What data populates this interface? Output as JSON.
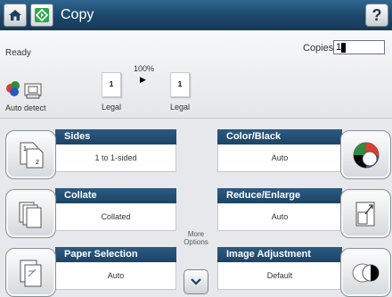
{
  "header": {
    "title": "Copy",
    "home_icon": "home-icon",
    "app_icon": "copy-start-icon",
    "help_label": "?"
  },
  "status": {
    "state": "Ready",
    "copies_label": "Copies:",
    "copies_value": "1",
    "zoom": "100%",
    "original_page": "1",
    "original_paper": "Legal",
    "output_page": "1",
    "output_paper": "Legal",
    "detect_label": "Auto detect"
  },
  "tiles": {
    "sides": {
      "title": "Sides",
      "value": "1 to 1-sided"
    },
    "collate": {
      "title": "Collate",
      "value": "Collated"
    },
    "paper_selection": {
      "title": "Paper Selection",
      "value": "Auto"
    },
    "color_black": {
      "title": "Color/Black",
      "value": "Auto"
    },
    "reduce_enlarge": {
      "title": "Reduce/Enlarge",
      "value": "Auto"
    },
    "image_adjustment": {
      "title": "Image Adjustment",
      "value": "Default"
    }
  },
  "more_options": {
    "line1": "More",
    "line2": "Options"
  },
  "colors": {
    "header_blue": "#1d4466",
    "tile_head": "#2b5a82",
    "start_green": "#2ea84a"
  }
}
